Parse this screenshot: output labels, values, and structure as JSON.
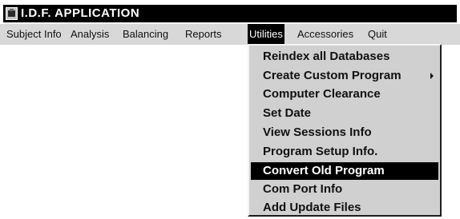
{
  "window": {
    "title": "I.D.F. APPLICATION",
    "icon": "app-icon"
  },
  "menubar": {
    "items": [
      {
        "label": "Subject Info"
      },
      {
        "label": "Analysis"
      },
      {
        "label": "Balancing"
      },
      {
        "label": "Reports"
      },
      {
        "label": "Utilities",
        "active": true
      },
      {
        "label": "Accessories"
      },
      {
        "label": "Quit"
      }
    ]
  },
  "utilities_menu": {
    "items": [
      {
        "label": "Reindex all Databases"
      },
      {
        "label": "Create Custom Program",
        "submenu": true
      },
      {
        "label": "Computer Clearance"
      },
      {
        "label": "Set Date"
      },
      {
        "label": "View Sessions Info"
      },
      {
        "label": "Program Setup Info."
      },
      {
        "label": "Convert Old Program",
        "highlighted": true
      },
      {
        "label": "Com Port Info"
      },
      {
        "label": "Add Update Files"
      }
    ]
  },
  "colors": {
    "titlebar": "#000000",
    "menubar": "#d8d8d8",
    "menu_background": "#d0d0d0",
    "highlight": "#000000",
    "highlight_text": "#ffffff"
  }
}
